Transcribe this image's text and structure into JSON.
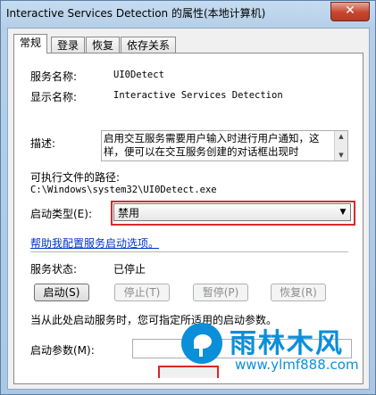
{
  "window": {
    "title": "Interactive Services Detection 的属性(本地计算机)",
    "close_label": "✕"
  },
  "tabs": [
    {
      "label": "常规",
      "active": true
    },
    {
      "label": "登录",
      "active": false
    },
    {
      "label": "恢复",
      "active": false
    },
    {
      "label": "依存关系",
      "active": false
    }
  ],
  "general": {
    "service_name_label": "服务名称:",
    "service_name_value": "UI0Detect",
    "display_name_label": "显示名称:",
    "display_name_value": "Interactive Services Detection",
    "description_label": "描述:",
    "description_value": "启用交互服务需要用户输入时进行用户通知，这样，便可以在交互服务创建的对话框出现时",
    "exe_path_label": "可执行文件的路径:",
    "exe_path_value": "C:\\Windows\\system32\\UI0Detect.exe",
    "startup_type_label": "启动类型(E):",
    "startup_type_value": "禁用",
    "help_link": "帮助我配置服务启动选项。",
    "service_status_label": "服务状态:",
    "service_status_value": "已停止",
    "buttons": {
      "start": "启动(S)",
      "stop": "停止(T)",
      "pause": "暂停(P)",
      "resume": "恢复(R)"
    },
    "start_hint": "当从此处启动服务时，您可指定所适用的启动参数。",
    "start_params_label": "启动参数(M):",
    "start_params_value": ""
  },
  "watermark": {
    "title": "雨林木风",
    "url": "www.ylmf888.com"
  },
  "colors": {
    "highlight": "#d62a2a",
    "link": "#0033cc",
    "watermark": "#0a8fd8"
  }
}
